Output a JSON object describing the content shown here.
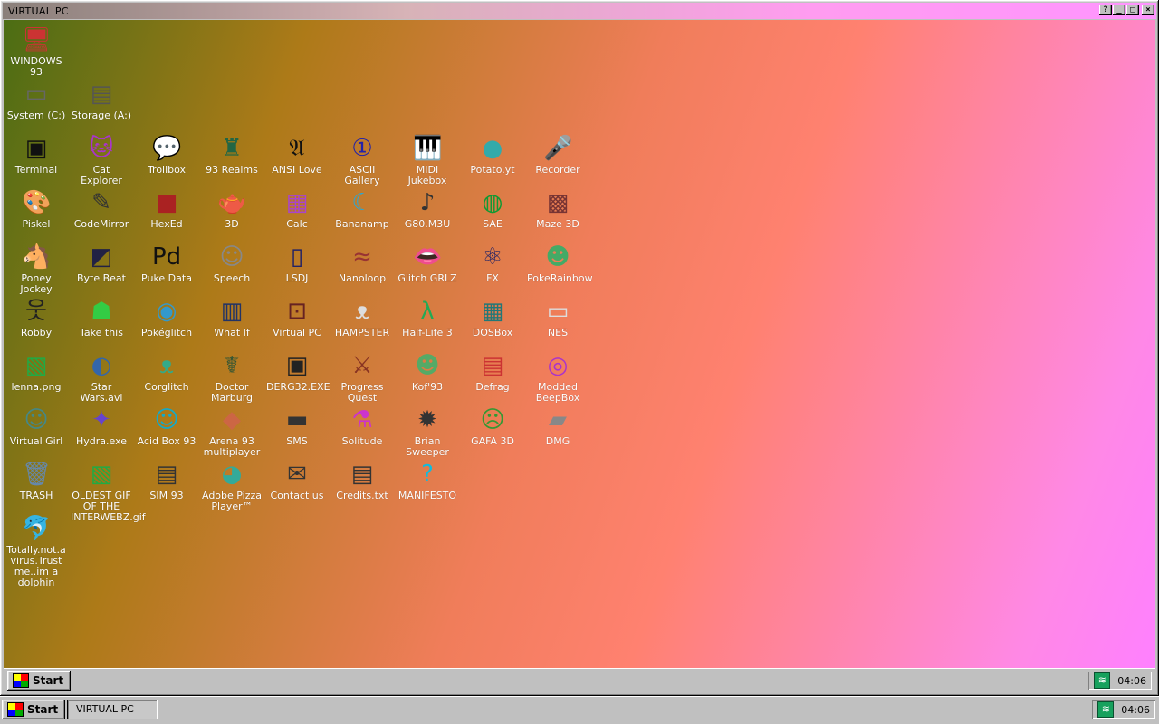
{
  "window": {
    "title": "VIRTUAL PC",
    "buttons": [
      "?",
      "_",
      "□",
      "×"
    ]
  },
  "desktop": {
    "icons": [
      {
        "label": "WINDOWS 93",
        "icon": "computer-icon"
      },
      {
        "label": "System (C:)",
        "icon": "drive-icon"
      },
      {
        "label": "Storage (A:)",
        "icon": "floppy-drive-icon"
      },
      {
        "label": "Terminal",
        "icon": "terminal-icon"
      },
      {
        "label": "Cat Explorer",
        "icon": "cat-icon"
      },
      {
        "label": "Trollbox",
        "icon": "chat-icon"
      },
      {
        "label": "93 Realms",
        "icon": "realms-icon"
      },
      {
        "label": "ANSI Love",
        "icon": "ansi-icon"
      },
      {
        "label": "ASCII Gallery",
        "icon": "ascii-icon"
      },
      {
        "label": "MIDI Jukebox",
        "icon": "piano-icon"
      },
      {
        "label": "Potato.yt",
        "icon": "potato-icon"
      },
      {
        "label": "Recorder",
        "icon": "microphone-icon"
      },
      {
        "label": "Piskel",
        "icon": "palette-icon"
      },
      {
        "label": "CodeMirror",
        "icon": "code-icon"
      },
      {
        "label": "HexEd",
        "icon": "cube-icon"
      },
      {
        "label": "3D",
        "icon": "teapot-icon"
      },
      {
        "label": "Calc",
        "icon": "calculator-icon"
      },
      {
        "label": "Bananamp",
        "icon": "banana-icon"
      },
      {
        "label": "G80.M3U",
        "icon": "playlist-icon"
      },
      {
        "label": "SAE",
        "icon": "ball-icon"
      },
      {
        "label": "Maze 3D",
        "icon": "maze-icon"
      },
      {
        "label": "Poney Jockey",
        "icon": "pony-icon"
      },
      {
        "label": "Byte Beat",
        "icon": "bytebeat-icon"
      },
      {
        "label": "Puke Data",
        "icon": "pd-icon"
      },
      {
        "label": "Speech",
        "icon": "face-icon"
      },
      {
        "label": "LSDJ",
        "icon": "gameboy-icon"
      },
      {
        "label": "Nanoloop",
        "icon": "wave-icon"
      },
      {
        "label": "Glitch GRLZ",
        "icon": "lips-icon"
      },
      {
        "label": "FX",
        "icon": "atom-icon"
      },
      {
        "label": "PokeRainbow",
        "icon": "pokemon-icon"
      },
      {
        "label": "Robby",
        "icon": "stickman-icon"
      },
      {
        "label": "Take this",
        "icon": "frog-icon"
      },
      {
        "label": "Pokéglitch",
        "icon": "glitch-icon"
      },
      {
        "label": "What If",
        "icon": "window-icon"
      },
      {
        "label": "Virtual PC",
        "icon": "virtual-pc-icon"
      },
      {
        "label": "HAMPSTER",
        "icon": "hamster-icon"
      },
      {
        "label": "Half-Life 3",
        "icon": "lambda-icon"
      },
      {
        "label": "DOSBox",
        "icon": "dosbox-icon"
      },
      {
        "label": "NES",
        "icon": "nes-icon"
      },
      {
        "label": "lenna.png",
        "icon": "image-file-icon"
      },
      {
        "label": "Star Wars.avi",
        "icon": "planet-icon"
      },
      {
        "label": "Corglitch",
        "icon": "corgi-icon"
      },
      {
        "label": "Doctor Marburg",
        "icon": "doctor-icon"
      },
      {
        "label": "DERG32.EXE",
        "icon": "monitor-face-icon"
      },
      {
        "label": "Progress Quest",
        "icon": "swords-icon"
      },
      {
        "label": "Kof'93",
        "icon": "fighter-icon"
      },
      {
        "label": "Defrag",
        "icon": "defrag-icon"
      },
      {
        "label": "Modded BeepBox",
        "icon": "ring-icon"
      },
      {
        "label": "Virtual Girl",
        "icon": "girl-face-icon"
      },
      {
        "label": "Hydra.exe",
        "icon": "hydra-icon"
      },
      {
        "label": "Acid Box 93",
        "icon": "smiley-icon"
      },
      {
        "label": "Arena 93 multiplayer",
        "icon": "arena-cube-icon"
      },
      {
        "label": "SMS",
        "icon": "console-icon"
      },
      {
        "label": "Solitude",
        "icon": "bottle-icon"
      },
      {
        "label": "Brian Sweeper",
        "icon": "mine-icon"
      },
      {
        "label": "GAFA 3D",
        "icon": "zombie-head-icon"
      },
      {
        "label": "DMG",
        "icon": "dmg-icon"
      },
      {
        "label": "TRASH",
        "icon": "trash-icon"
      },
      {
        "label": "OLDEST GIF OF THE INTERWEBZ.gif",
        "icon": "gif-file-icon"
      },
      {
        "label": "SIM 93",
        "icon": "book-icon"
      },
      {
        "label": "Adobe Pizza Player™",
        "icon": "pizza-icon"
      },
      {
        "label": "Contact us",
        "icon": "contact-icon"
      },
      {
        "label": "Credits.txt",
        "icon": "text-file-icon"
      },
      {
        "label": "MANIFESTO",
        "icon": "question-icon"
      },
      {
        "label": "Totally.not.a virus.Trust me..im a dolphin",
        "icon": "dolphin-icon"
      }
    ]
  },
  "inner_taskbar": {
    "start_label": "Start",
    "clock": "04:06"
  },
  "host_taskbar": {
    "start_label": "Start",
    "task_label": "VIRTUAL PC",
    "clock": "04:06"
  }
}
